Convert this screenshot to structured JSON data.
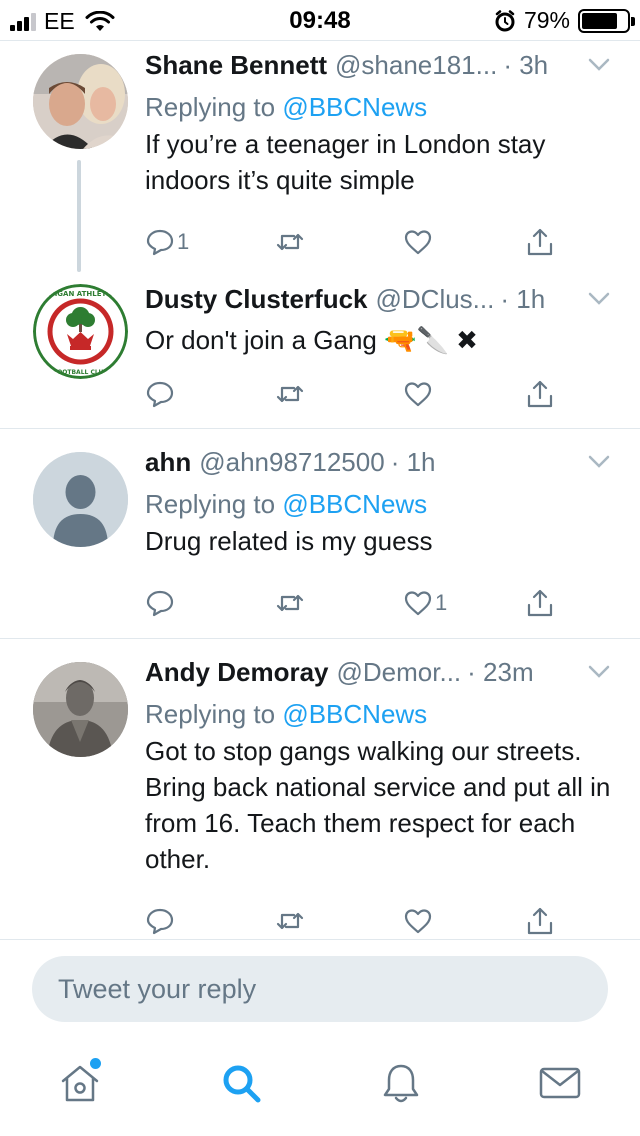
{
  "status_bar": {
    "carrier": "EE",
    "time": "09:48",
    "battery_percent": "79%",
    "battery_level": 0.79,
    "signal_bars_active": 3,
    "signal_bars_total": 4
  },
  "tweets": [
    {
      "name": "Shane Bennett",
      "handle": "@shane181...",
      "time": "· 3h",
      "replying_prefix": "Replying to ",
      "replying_to": "@BBCNews",
      "text": "If you’re a teenager in London stay indoors it’s quite simple",
      "reply_count": "1",
      "retweet_count": "",
      "like_count": ""
    },
    {
      "name": "Dusty Clusterfuck",
      "handle": "@DClus...",
      "time": "· 1h",
      "text": "Or don't join a Gang 🔫🔪 ✖",
      "avatar_text": "WIGAN ATHLETIC FOOTBALL CLUB",
      "reply_count": "",
      "retweet_count": "",
      "like_count": ""
    },
    {
      "name": "ahn",
      "handle": "@ahn98712500",
      "time": "· 1h",
      "replying_prefix": "Replying to ",
      "replying_to": "@BBCNews",
      "text": "Drug related is my guess",
      "reply_count": "",
      "retweet_count": "",
      "like_count": "1"
    },
    {
      "name": "Andy Demoray",
      "handle": "@Demor...",
      "time": "· 23m",
      "replying_prefix": "Replying to ",
      "replying_to": "@BBCNews",
      "text": "Got to stop gangs walking our streets. Bring back national service and put all in from 16. Teach them respect for each other.",
      "reply_count": "",
      "retweet_count": "",
      "like_count": ""
    }
  ],
  "reply_box": {
    "placeholder": "Tweet your reply"
  },
  "tab_bar": {
    "items": [
      "home-icon",
      "search-icon",
      "notifications-icon",
      "messages-icon"
    ],
    "active": "search-icon",
    "home_has_new": true
  },
  "colors": {
    "accent": "#1da1f2",
    "secondary_text": "#657786",
    "primary_text": "#14171a",
    "divider": "#e1e8ed",
    "icon": "#657786"
  }
}
